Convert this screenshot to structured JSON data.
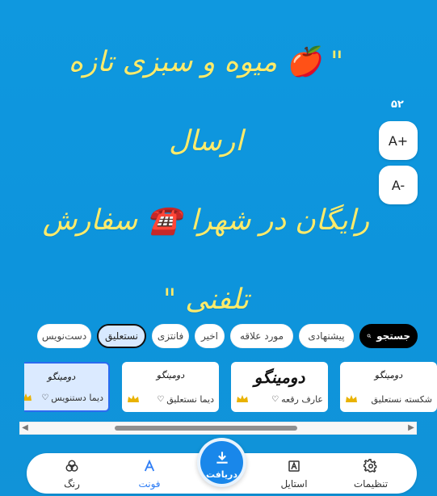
{
  "canvas": {
    "text": "\" 🍎 میوه و سبزی تازه ارسال\nرایگان در شهرا ☎️ سفارش\nتلفنی \"",
    "text_color": "#ffeb6a",
    "background_color": "#0f98df"
  },
  "font_size": {
    "value": "۵۲",
    "increase_label": "A+",
    "decrease_label": "A-"
  },
  "tabs": {
    "search_label": "جستجو",
    "items": [
      {
        "label": "پیشنهادی"
      },
      {
        "label": "مورد علاقه"
      },
      {
        "label": "اخیر"
      },
      {
        "label": "فانتزی"
      },
      {
        "label": "نستعلیق",
        "active": true
      },
      {
        "label": "دست‌نویس"
      }
    ]
  },
  "fonts": {
    "items": [
      {
        "sample": "دومینگو",
        "name": "شکسته نستعلیق",
        "premium": true
      },
      {
        "sample": "دومینگو",
        "name": "عارف رقعه",
        "premium": true
      },
      {
        "sample": "دومینگو",
        "name": "دیما نستعلیق",
        "premium": true
      },
      {
        "sample": "دومینگو",
        "name": "دیما دستنویس",
        "premium": true,
        "selected": true
      }
    ]
  },
  "bottom_nav": {
    "settings_label": "تنظیمات",
    "style_label": "استایل",
    "download_label": "دریافت",
    "font_label": "فونت",
    "color_label": "رنگ",
    "active_color": "#2e7df5"
  }
}
